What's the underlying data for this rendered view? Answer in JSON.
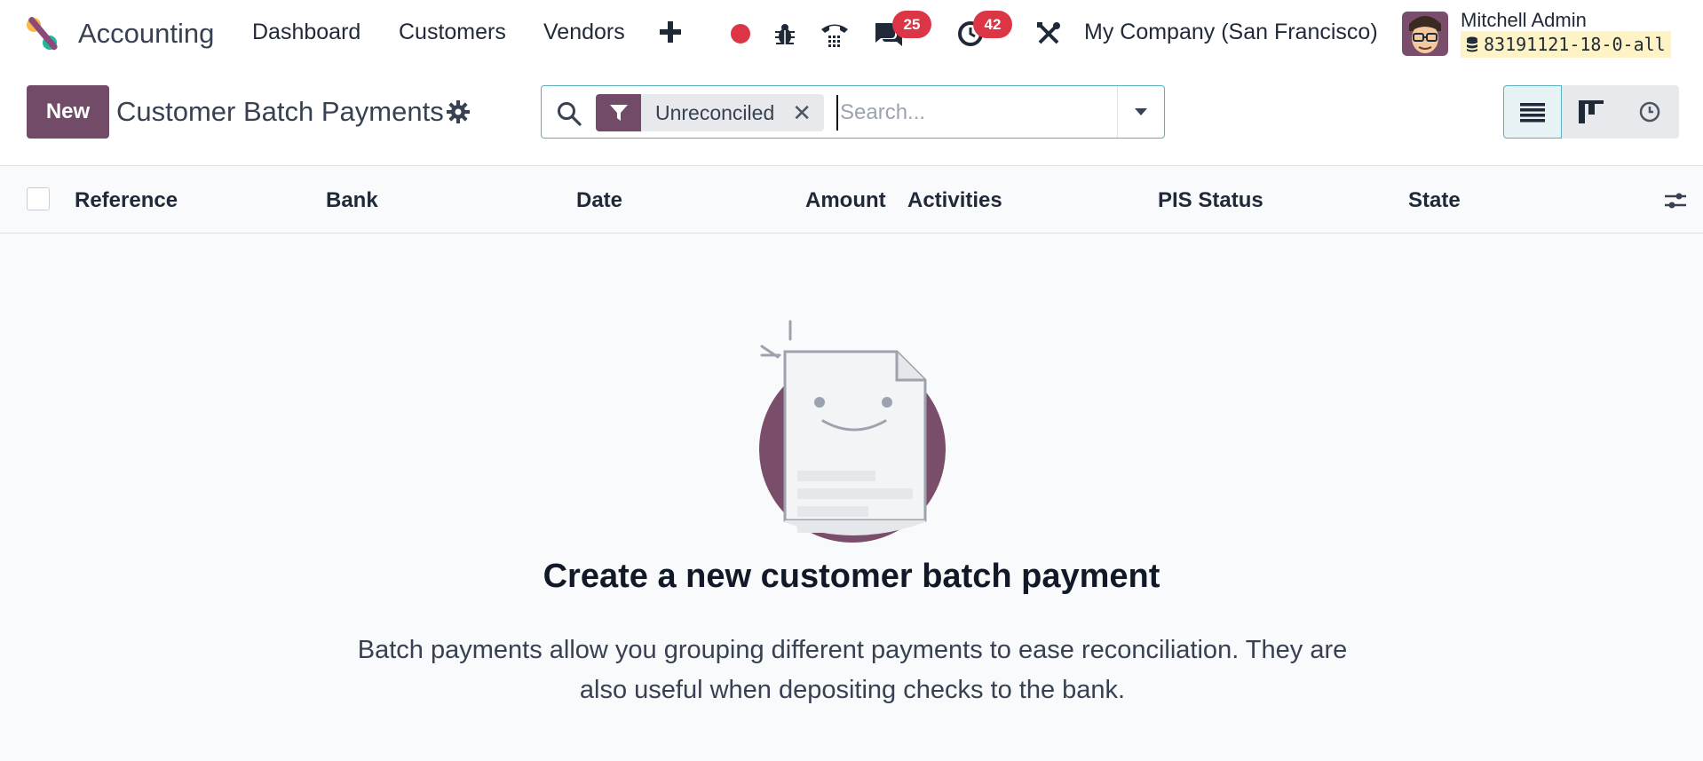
{
  "navbar": {
    "app_name": "Accounting",
    "menu": [
      "Dashboard",
      "Customers",
      "Vendors"
    ],
    "messages_count": "25",
    "activities_count": "42",
    "company": "My Company (San Francisco)",
    "user_name": "Mitchell Admin",
    "database": "83191121-18-0-all",
    "icons": [
      "app-logo",
      "plus-icon",
      "record-icon",
      "bug-icon",
      "phone-icon",
      "chat-icon",
      "clock-icon",
      "tools-icon",
      "database-icon"
    ]
  },
  "control_panel": {
    "new_label": "New",
    "breadcrumb": "Customer Batch Payments",
    "search": {
      "facet_value": "Unreconciled",
      "placeholder": "Search..."
    },
    "views": [
      "list",
      "kanban",
      "activity"
    ]
  },
  "list": {
    "columns": [
      "Reference",
      "Bank",
      "Date",
      "Amount",
      "Activities",
      "PIS Status",
      "State"
    ]
  },
  "empty_state": {
    "title": "Create a new customer batch payment",
    "text": "Batch payments allow you grouping different payments to ease reconciliation. They are also useful when depositing checks to the bank."
  },
  "colors": {
    "brand": "#714b67",
    "badge": "#dc3545",
    "focus": "#5ab0bc"
  }
}
